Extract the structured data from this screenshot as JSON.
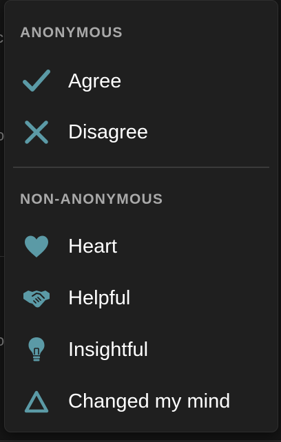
{
  "accent_color": "#5b9aa6",
  "sections": [
    {
      "header": "ANONYMOUS",
      "items": [
        {
          "label": "Agree",
          "icon": "check-icon"
        },
        {
          "label": "Disagree",
          "icon": "cross-icon"
        }
      ]
    },
    {
      "header": "NON-ANONYMOUS",
      "items": [
        {
          "label": "Heart",
          "icon": "heart-icon"
        },
        {
          "label": "Helpful",
          "icon": "handshake-icon"
        },
        {
          "label": "Insightful",
          "icon": "lightbulb-icon"
        },
        {
          "label": "Changed my mind",
          "icon": "triangle-icon"
        }
      ]
    }
  ]
}
